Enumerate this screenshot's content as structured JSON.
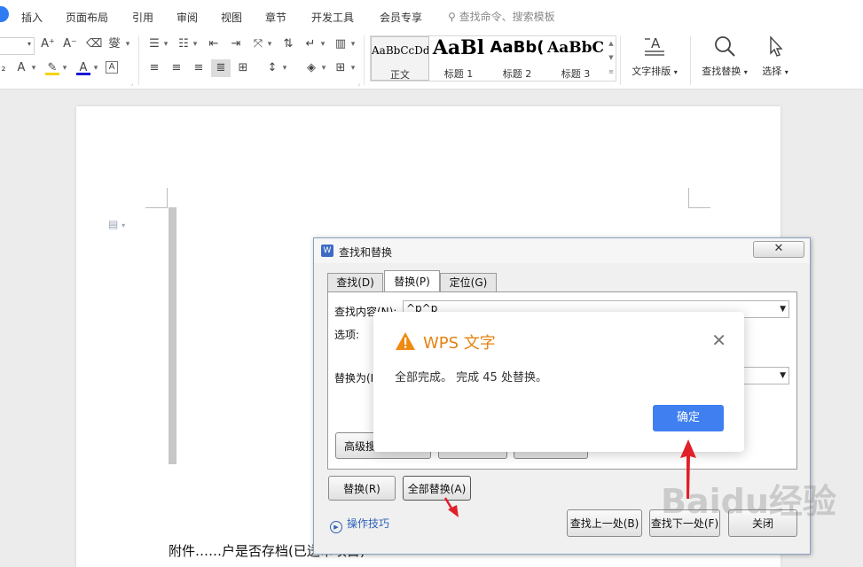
{
  "menu": {
    "items": [
      "插入",
      "页面布局",
      "引用",
      "审阅",
      "视图",
      "章节",
      "开发工具",
      "会员专享"
    ],
    "search_placeholder": "查找命令、搜索模板"
  },
  "ribbon": {
    "styles": [
      {
        "sample": "AaBbCcDd",
        "label": "正文"
      },
      {
        "sample": "AaBl",
        "label": "标题 1"
      },
      {
        "sample": "AaBb(",
        "label": "标题 2"
      },
      {
        "sample": "AaBbC",
        "label": "标题 3"
      }
    ],
    "text_layout_label": "文字排版",
    "find_replace_label": "查找替换",
    "select_label": "选择"
  },
  "document": {
    "visible_text": "附件……户是否存档(已送审项目)"
  },
  "dialog": {
    "title": "查找和替换",
    "tabs": [
      "查找(D)",
      "替换(P)",
      "定位(G)"
    ],
    "find_label": "查找内容(N):",
    "find_value": "^p^p",
    "options_label": "选项:",
    "replace_label": "替换为(I",
    "advanced_button": "高级搜",
    "replace_button": "替换(R)",
    "replace_all_button": "全部替换(A)",
    "tips_link": "操作技巧",
    "find_prev_button": "查找上一处(B)",
    "find_next_button": "查找下一处(F)",
    "close_button": "关闭"
  },
  "message": {
    "title": "WPS 文字",
    "text": "全部完成。 完成 45 处替换。",
    "ok_button": "确定"
  },
  "watermark": "Baidu经验",
  "colors": {
    "accent": "#3f7ff0",
    "warning": "#e5830f",
    "annotation_arrow": "#e0202a"
  }
}
